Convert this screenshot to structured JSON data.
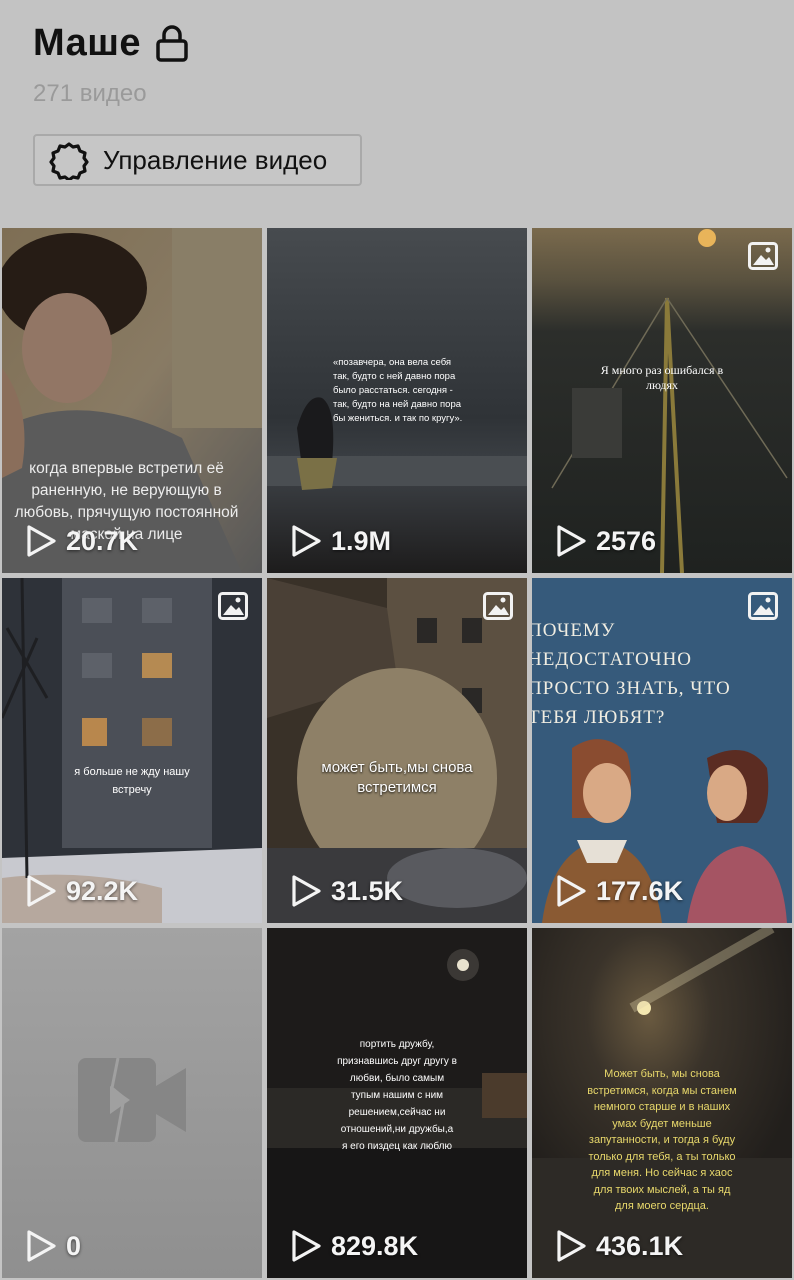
{
  "profile": {
    "playlist_title": "Маше",
    "video_count": "271 видео",
    "manage_label": "Управление видео"
  },
  "videos": [
    {
      "views": "20.7K",
      "caption": "когда впервые встретил её раненную, не верующую в любовь, прячущую постоянной маской на лице",
      "is_photo": false
    },
    {
      "views": "1.9M",
      "caption": "«позавчера, она вела себя так, будто с ней давно пора было расстаться. сегодня - так, будто на ней давно пора бы жениться. и так по кругу».",
      "is_photo": false
    },
    {
      "views": "2576",
      "caption": "Я много раз ошибался в людях",
      "is_photo": true
    },
    {
      "views": "92.2K",
      "caption": "я больше не жду нашу встречу",
      "is_photo": true
    },
    {
      "views": "31.5K",
      "caption": "может быть,мы снова встретимся",
      "is_photo": true
    },
    {
      "views": "177.6K",
      "caption": "ПОЧЕМУ НЕДОСТАТОЧНО ПРОСТО ЗНАТЬ, ЧТО ТЕБЯ ЛЮБЯТ?",
      "is_photo": true
    },
    {
      "views": "0",
      "caption": "",
      "is_photo": false
    },
    {
      "views": "829.8K",
      "caption": "портить дружбу, признавшись друг другу в любви, было самым тупым нашим с ним решением,сейчас ни отношений,ни дружбы,а я его пиздец как люблю",
      "is_photo": false
    },
    {
      "views": "436.1K",
      "caption": "Может быть, мы снова встретимся, когда мы станем немного старше и в наших умах будет меньше запутанности, и тогда я буду только для тебя, а ты только для меня. Но сейчас я хаос для твоих мыслей, а ты яд для моего сердца.",
      "is_photo": false
    }
  ],
  "icons": {
    "lock": "lock-icon",
    "gear": "gear-icon",
    "play": "play-icon",
    "photo": "photo-icon",
    "broken_video": "broken-video-icon"
  }
}
